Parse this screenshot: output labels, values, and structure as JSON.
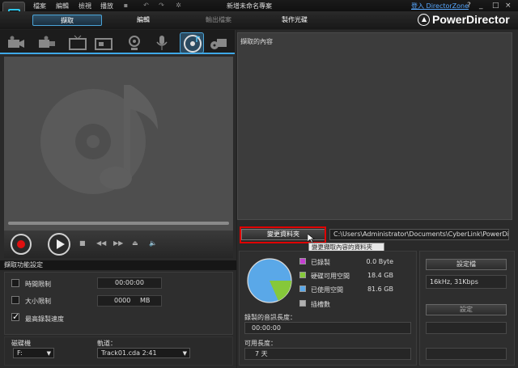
{
  "menu": [
    "檔案",
    "編輯",
    "檢視",
    "播放"
  ],
  "project_title": "新增未命名專案",
  "login_link": "登入 DirectorZone",
  "window_controls": {
    "help": "?",
    "minimize": "_",
    "maximize": "□",
    "close": "×"
  },
  "modules": {
    "capture": "擷取",
    "edit": "編輯",
    "output": "輸出檔案",
    "disc": "製作光碟"
  },
  "brand": "PowerDirector",
  "content_label": "擷取的內容",
  "folder_button": "變更資料夾",
  "folder_path": "C:\\Users\\Administrator\\Documents\\CyberLink\\PowerDire...\\",
  "tooltip": "變更擷取內容的資料夾",
  "settings_header": "擷取功能設定",
  "settings": {
    "time_limit_label": "時間限制",
    "time_limit_value": "00:00:00",
    "size_limit_label": "大小限制",
    "size_limit_value": "0000",
    "size_unit": "MB",
    "max_speed_label": "最高錄製速度"
  },
  "drive": {
    "label": "磁碟機",
    "value": "F:"
  },
  "track": {
    "label": "軌道：",
    "value": "Track01.cda  2:41"
  },
  "legend": [
    {
      "label": "已錄製",
      "value": "0.0 Byte",
      "color": "#c43fd0"
    },
    {
      "label": "硬碟可用空間",
      "value": "18.4 GB",
      "color": "#86c83a"
    },
    {
      "label": "已使用空間",
      "value": "81.6 GB",
      "color": "#5aa8e8"
    },
    {
      "label": "插槽數",
      "value": "",
      "color": "#b0b0b0"
    }
  ],
  "disk_usage": {
    "used_fraction": 0.816,
    "free_fraction": 0.184
  },
  "recorded_length_label": "錄製的音訊長度：",
  "recorded_length_value": "00:00:00",
  "available_length_label": "可用長度：",
  "available_length_value": "7 天",
  "profile_button": "設定檔",
  "profile_value": "16kHz,  31Kbps",
  "settings_button": "設定"
}
